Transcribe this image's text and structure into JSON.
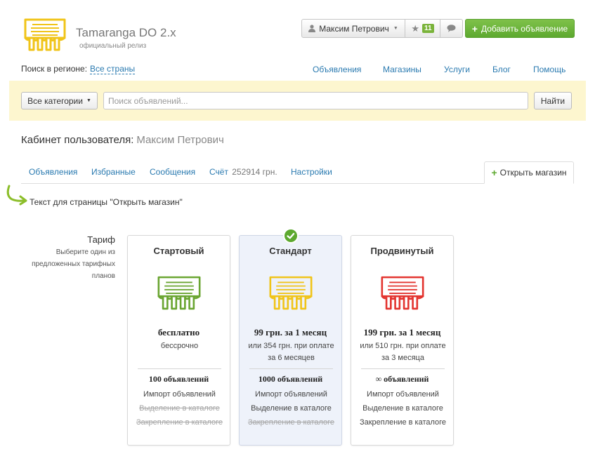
{
  "colors": {
    "accent_green": "#5da92f",
    "link": "#2a7ab0",
    "logo_yellow": "#f0c419",
    "plan_green": "#6aa531",
    "plan_red": "#e3342f",
    "search_bg": "#fdf6cf"
  },
  "logo": {
    "title": "Tamaranga DO 2.x",
    "subtitle": "официальный релиз",
    "icon": "brush-logo-icon"
  },
  "header": {
    "user_name": "Максим Петрович",
    "favorites_count": "11",
    "add_listing": "Добавить объявление"
  },
  "region": {
    "label": "Поиск в регионе:",
    "value": "Все страны"
  },
  "nav": [
    "Объявления",
    "Магазины",
    "Услуги",
    "Блог",
    "Помощь"
  ],
  "search": {
    "category": "Все категории",
    "placeholder": "Поиск объявлений...",
    "button": "Найти"
  },
  "cabinet": {
    "title": "Кабинет пользователя:",
    "user": "Максим Петрович"
  },
  "tabs": {
    "listings": "Объявления",
    "favorites": "Избранные",
    "messages": "Сообщения",
    "account": "Счёт",
    "account_amount": "252914 грн.",
    "settings": "Настройки",
    "open_shop": "Открыть магазин"
  },
  "page_text": "Текст для страницы \"Открыть магазин\"",
  "tariff": {
    "title": "Тариф",
    "description": "Выберите один из предложенных тарифных планов",
    "selected_index": 1,
    "plans": [
      {
        "name": "Стартовый",
        "price": "бесплатно",
        "period": "бессрочно",
        "listings": "100 объявлений",
        "features": [
          "Импорт объявлений",
          "Выделение в каталоге",
          "Закрепление в каталоге"
        ],
        "features_enabled": [
          true,
          false,
          false
        ]
      },
      {
        "name": "Стандарт",
        "price": "99 грн. за 1 месяц",
        "period": "или 354 грн. при оплате за 6 месяцев",
        "listings": "1000 объявлений",
        "features": [
          "Импорт объявлений",
          "Выделение в каталоге",
          "Закрепление в каталоге"
        ],
        "features_enabled": [
          true,
          true,
          false
        ]
      },
      {
        "name": "Продвинутый",
        "price": "199 грн. за 1 месяц",
        "period": "или 510 грн. при оплате за 3 месяца",
        "listings": "∞ объявлений",
        "features": [
          "Импорт объявлений",
          "Выделение в каталоге",
          "Закрепление в каталоге"
        ],
        "features_enabled": [
          true,
          true,
          true
        ]
      }
    ]
  }
}
